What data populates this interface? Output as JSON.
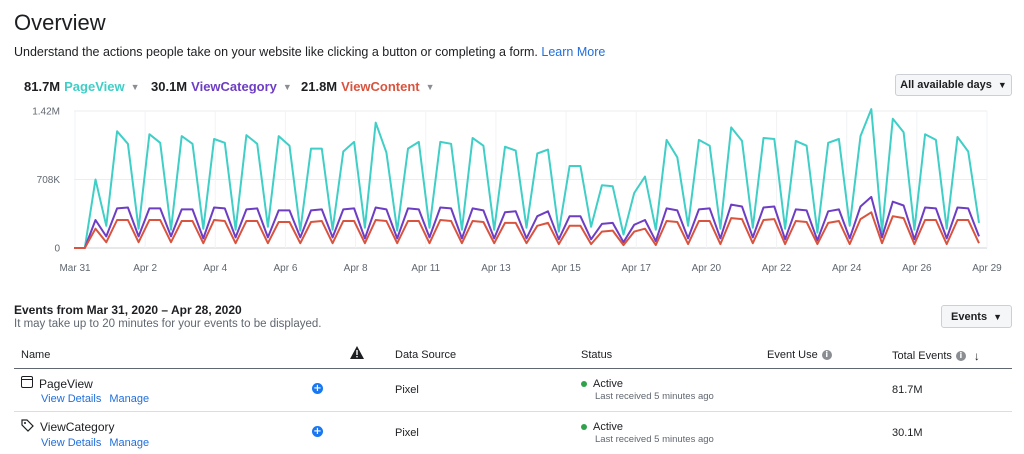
{
  "page": {
    "title": "Overview",
    "subtitle": "Understand the actions people take on your website like clicking a button or completing a form.",
    "learn_more": "Learn More"
  },
  "metrics": [
    {
      "value": "81.7M",
      "name": "PageView",
      "color": "#3fcfc7"
    },
    {
      "value": "30.1M",
      "name": "ViewCategory",
      "color": "#6d3ec4"
    },
    {
      "value": "21.8M",
      "name": "ViewContent",
      "color": "#d9543f"
    }
  ],
  "date_range_select": "All available days",
  "chart_data": {
    "type": "line",
    "y_tick_labels": [
      "1.42M",
      "708K",
      "0"
    ],
    "ylim": [
      0,
      1420000
    ],
    "x_tick_labels": [
      "Mar 31",
      "Apr 2",
      "Apr 4",
      "Apr 6",
      "Apr 8",
      "Apr 11",
      "Apr 13",
      "Apr 15",
      "Apr 17",
      "Apr 20",
      "Apr 22",
      "Apr 24",
      "Apr 26",
      "Apr 29"
    ],
    "grid": true,
    "series": [
      {
        "name": "PageView",
        "color": "#3fcfc7",
        "values": [
          0,
          0,
          710000,
          230000,
          1210000,
          1080000,
          200000,
          1180000,
          1090000,
          190000,
          1160000,
          1080000,
          200000,
          1130000,
          1090000,
          190000,
          1170000,
          1080000,
          220000,
          1160000,
          1060000,
          180000,
          1030000,
          1030000,
          190000,
          1000000,
          1100000,
          210000,
          1300000,
          990000,
          180000,
          1030000,
          1100000,
          210000,
          1100000,
          1080000,
          190000,
          1140000,
          1060000,
          190000,
          1050000,
          1010000,
          210000,
          980000,
          1020000,
          170000,
          850000,
          850000,
          220000,
          650000,
          640000,
          140000,
          570000,
          740000,
          190000,
          1120000,
          940000,
          230000,
          1120000,
          1060000,
          200000,
          1250000,
          1110000,
          210000,
          1140000,
          1130000,
          200000,
          1110000,
          1060000,
          160000,
          1090000,
          1130000,
          230000,
          1160000,
          1440000,
          170000,
          1340000,
          1200000,
          190000,
          1180000,
          1120000,
          200000,
          1150000,
          1000000,
          260000
        ]
      },
      {
        "name": "ViewCategory",
        "color": "#6d3ec4",
        "values": [
          0,
          0,
          290000,
          120000,
          410000,
          420000,
          120000,
          410000,
          410000,
          120000,
          400000,
          400000,
          100000,
          420000,
          410000,
          110000,
          400000,
          410000,
          110000,
          390000,
          390000,
          110000,
          390000,
          400000,
          110000,
          400000,
          410000,
          100000,
          420000,
          400000,
          100000,
          410000,
          400000,
          110000,
          420000,
          410000,
          100000,
          410000,
          390000,
          100000,
          370000,
          380000,
          100000,
          330000,
          380000,
          90000,
          330000,
          330000,
          90000,
          250000,
          260000,
          60000,
          240000,
          290000,
          70000,
          410000,
          390000,
          100000,
          400000,
          410000,
          100000,
          450000,
          430000,
          110000,
          420000,
          430000,
          90000,
          400000,
          390000,
          80000,
          380000,
          400000,
          100000,
          430000,
          530000,
          110000,
          480000,
          440000,
          90000,
          420000,
          410000,
          100000,
          420000,
          410000,
          120000
        ]
      },
      {
        "name": "ViewContent",
        "color": "#d9543f",
        "values": [
          0,
          0,
          200000,
          60000,
          290000,
          290000,
          60000,
          290000,
          290000,
          60000,
          280000,
          280000,
          50000,
          290000,
          280000,
          50000,
          280000,
          280000,
          50000,
          270000,
          270000,
          50000,
          270000,
          280000,
          50000,
          280000,
          280000,
          50000,
          290000,
          280000,
          50000,
          280000,
          280000,
          50000,
          290000,
          280000,
          50000,
          280000,
          270000,
          50000,
          260000,
          260000,
          50000,
          230000,
          260000,
          40000,
          230000,
          230000,
          40000,
          170000,
          180000,
          30000,
          170000,
          200000,
          30000,
          280000,
          270000,
          40000,
          280000,
          280000,
          40000,
          310000,
          300000,
          50000,
          290000,
          300000,
          40000,
          280000,
          270000,
          40000,
          260000,
          280000,
          40000,
          300000,
          370000,
          50000,
          330000,
          310000,
          40000,
          290000,
          290000,
          40000,
          290000,
          290000,
          50000
        ]
      }
    ]
  },
  "events": {
    "heading": "Events from Mar 31, 2020 – Apr 28, 2020",
    "note": "It may take up to 20 minutes for your events to be displayed.",
    "button": "Events",
    "columns": {
      "name": "Name",
      "data_source": "Data Source",
      "status": "Status",
      "event_use": "Event Use",
      "total_events": "Total Events"
    },
    "rows": [
      {
        "name": "PageView",
        "view_details": "View Details",
        "manage": "Manage",
        "data_source": "Pixel",
        "status": "Active",
        "status_sub": "Last received 5 minutes ago",
        "total": "81.7M",
        "icon": "page-icon"
      },
      {
        "name": "ViewCategory",
        "view_details": "View Details",
        "manage": "Manage",
        "data_source": "Pixel",
        "status": "Active",
        "status_sub": "Last received 5 minutes ago",
        "total": "30.1M",
        "icon": "tag-icon"
      }
    ]
  }
}
